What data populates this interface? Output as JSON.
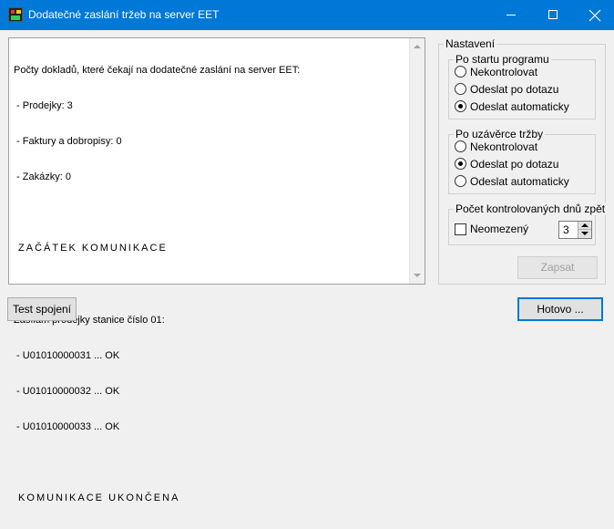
{
  "window": {
    "title": "Dodatečné zaslání tržeb na server EET"
  },
  "log": {
    "lines": [
      "Počty dokladů, které čekají na dodatečné zaslání na server EET:",
      " - Prodejky: 3",
      " - Faktury a dobropisy: 0",
      " - Zakázky: 0",
      "",
      " ZAČÁTEK KOMUNIKACE",
      "",
      "Zasílám prodejky stanice číslo 01:",
      " - U01010000031 ... OK",
      " - U01010000032 ... OK",
      " - U01010000033 ... OK",
      "",
      " KOMUNIKACE UKONČENA"
    ]
  },
  "settings": {
    "title": "Nastavení",
    "on_start": {
      "title": "Po startu programu",
      "options": [
        "Nekontrolovat",
        "Odeslat po dotazu",
        "Odeslat automaticky"
      ],
      "selected": "Odeslat automaticky"
    },
    "after_closing": {
      "title": "Po uzávěrce tržby",
      "options": [
        "Nekontrolovat",
        "Odeslat po dotazu",
        "Odeslat automaticky"
      ],
      "selected": "Odeslat po dotazu"
    },
    "days_back": {
      "title": "Počet kontrolovaných dnů zpět",
      "unlimited_label": "Neomezený",
      "unlimited_checked": false,
      "value": "3"
    },
    "save_label": "Zapsat"
  },
  "buttons": {
    "test_label": "Test spojení",
    "done_label": "Hotovo ..."
  },
  "colors": {
    "titlebar": "#0078d7",
    "focus_border": "#0078d7"
  }
}
